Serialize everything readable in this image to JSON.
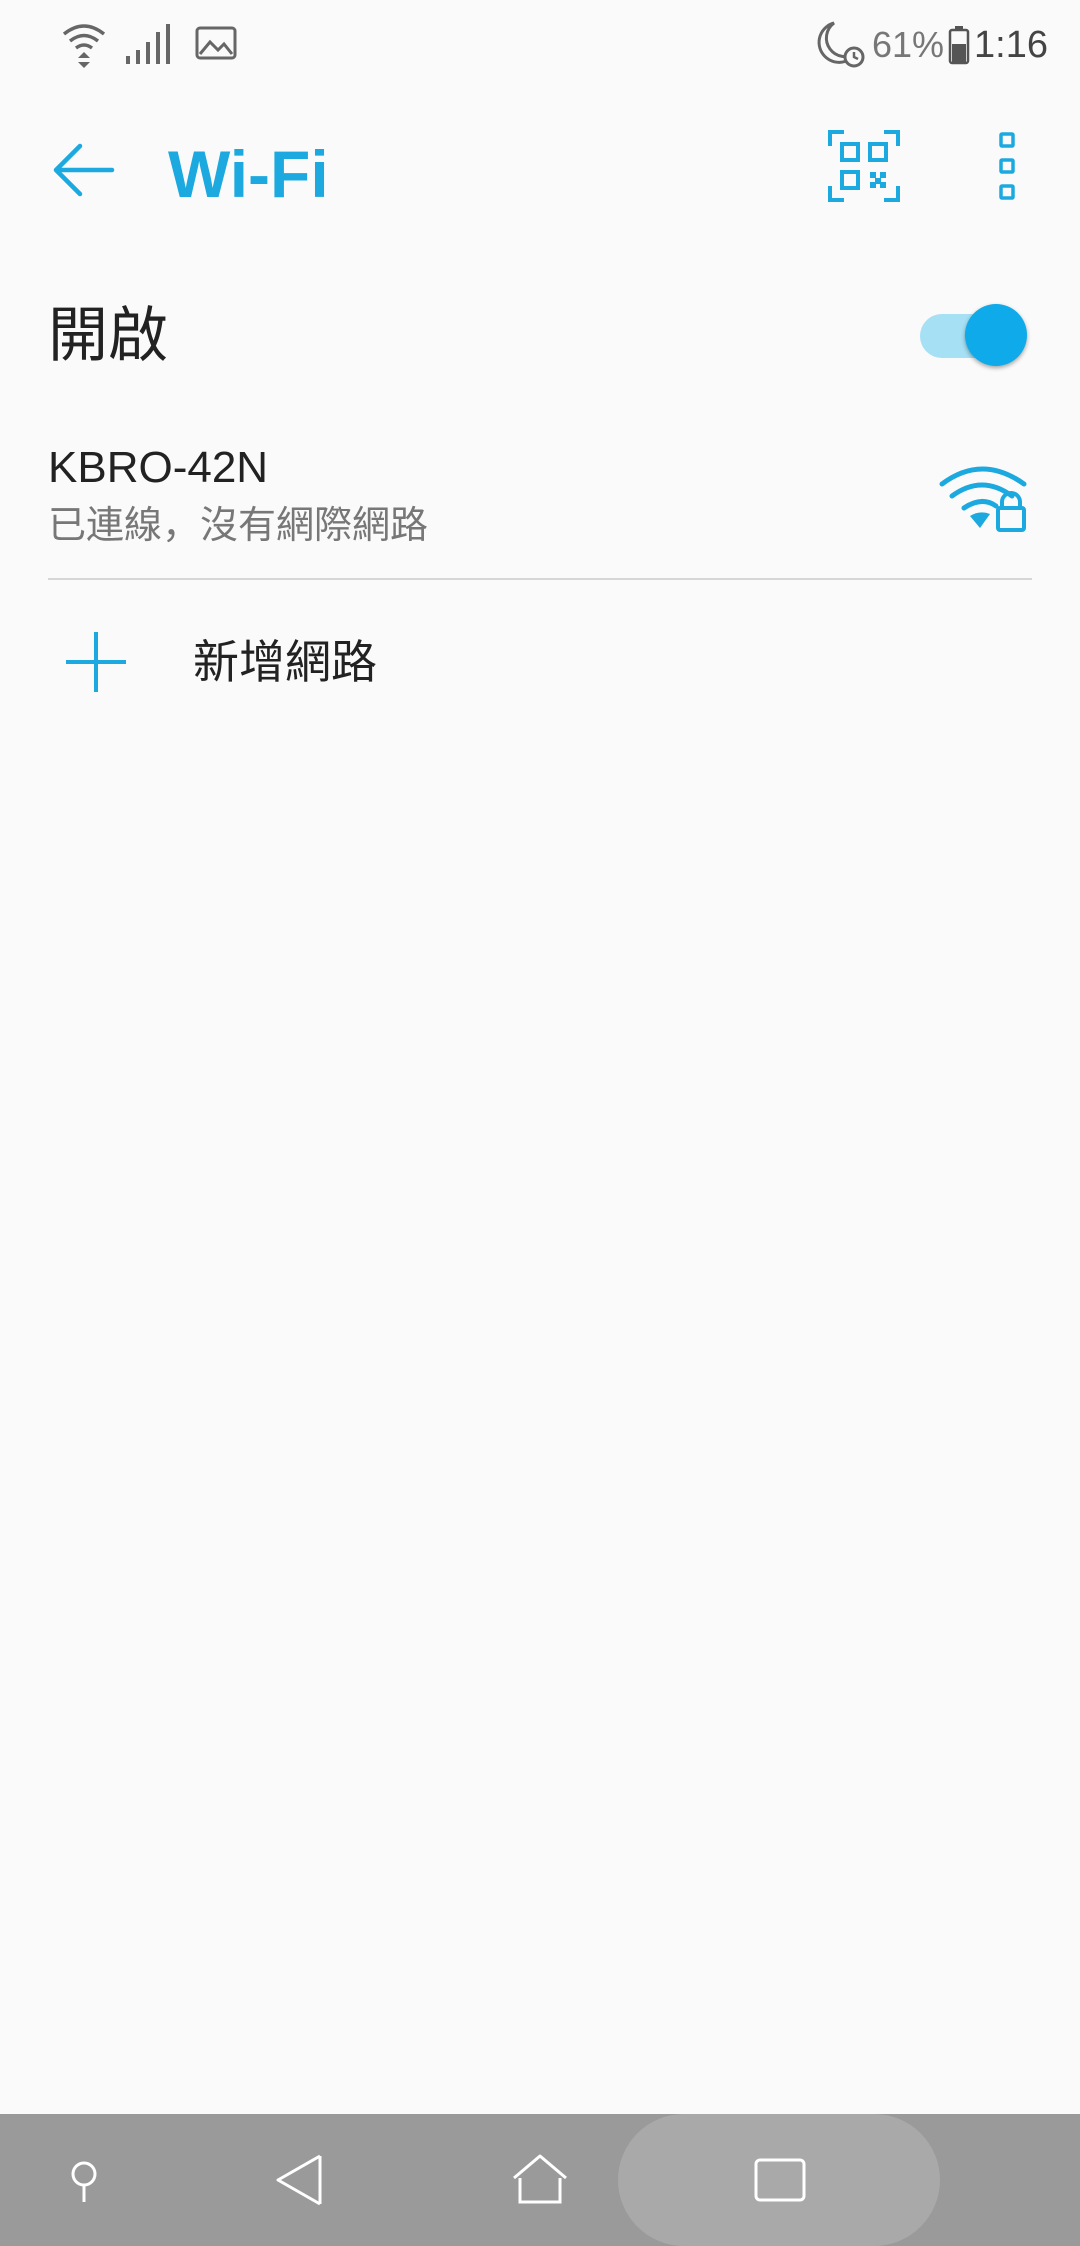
{
  "status_bar": {
    "icons_left": [
      "wifi-icon",
      "cell-signal-icon",
      "image-icon"
    ],
    "icons_right": [
      "moon-alarm-icon",
      "battery-icon"
    ],
    "battery_percent": "61%",
    "battery_level": 0.61,
    "time": "1:16"
  },
  "app_bar": {
    "title": "Wi-Fi",
    "back_icon": "arrow-back-icon",
    "qr_icon": "qr-code-icon",
    "more_icon": "more-vert-icon"
  },
  "wifi_toggle": {
    "label": "開啟",
    "on": true
  },
  "network": {
    "ssid": "KBRO-42N",
    "status": "已連線，沒有網際網路",
    "icon": "wifi-lock-icon"
  },
  "add_network": {
    "label": "新增網路",
    "icon": "plus-icon"
  },
  "nav_bar": {
    "buttons": [
      "assistant-icon",
      "back-triangle-icon",
      "home-icon",
      "recents-icon"
    ]
  },
  "colors": {
    "accent": "#1ca9df",
    "switch_thumb": "#0eaaea",
    "switch_track": "#a6e0f5",
    "background": "#fafafa",
    "nav_bar": "#9a9a9a"
  }
}
